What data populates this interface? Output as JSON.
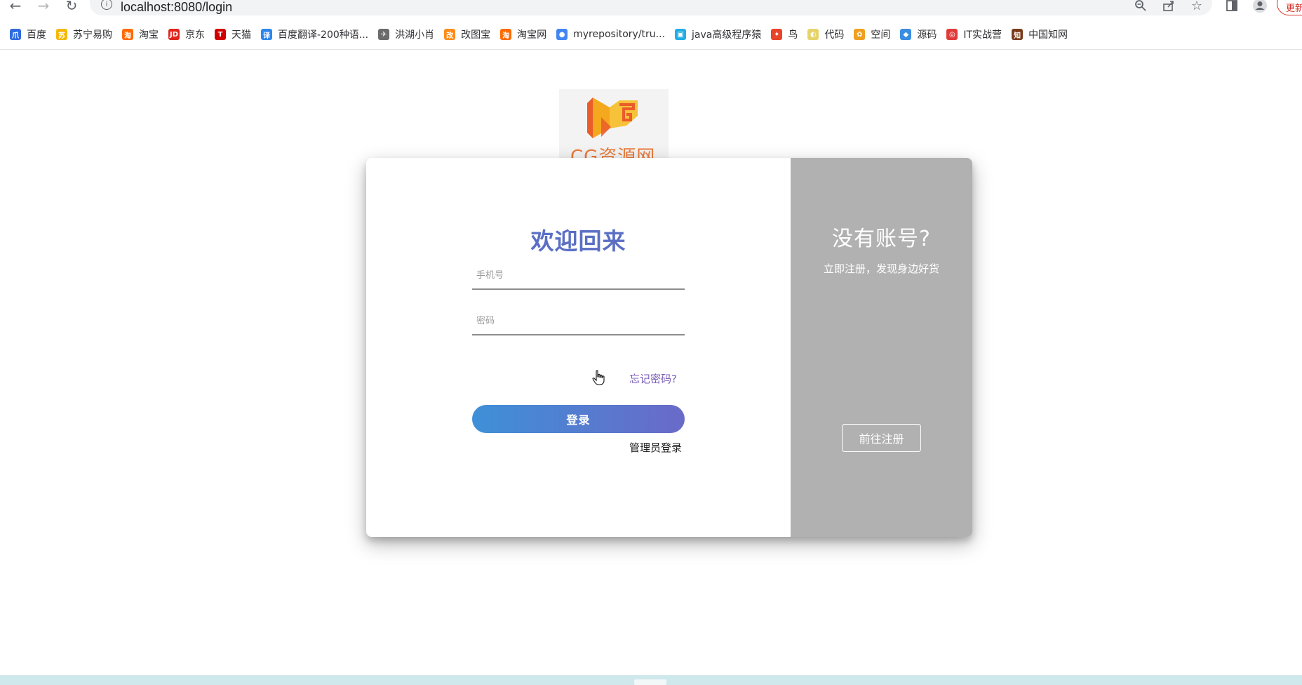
{
  "browser": {
    "url": "localhost:8080/login",
    "update_label": "更新",
    "bookmarks": [
      {
        "label": "百度",
        "icon": "baidu-paw-icon",
        "color": "#2f6be0"
      },
      {
        "label": "苏宁易购",
        "icon": "suning-icon",
        "color": "#f5b800"
      },
      {
        "label": "淘宝",
        "icon": "taobao-icon",
        "color": "#ff6a00"
      },
      {
        "label": "京东",
        "icon": "jd-icon",
        "color": "#e1251b"
      },
      {
        "label": "天猫",
        "icon": "tmall-icon",
        "color": "#d10000"
      },
      {
        "label": "百度翻译-200种语...",
        "icon": "translate-icon",
        "color": "#2e86ee"
      },
      {
        "label": "洪湖小肖",
        "icon": "bird-icon",
        "color": "#6b6b6b"
      },
      {
        "label": "改图宝",
        "icon": "gaitubao-icon",
        "color": "#ff8c1a"
      },
      {
        "label": "淘宝网",
        "icon": "taobao-icon",
        "color": "#ff6a00"
      },
      {
        "label": "myrepository/tru...",
        "icon": "chrome-icon",
        "color": "#4285f4"
      },
      {
        "label": "java高级程序猿",
        "icon": "bilibili-icon",
        "color": "#23ade5"
      },
      {
        "label": "鸟",
        "icon": "bird-icon",
        "color": "#e8442a"
      },
      {
        "label": "代码",
        "icon": "moon-icon",
        "color": "#e6d36a"
      },
      {
        "label": "空间",
        "icon": "qzone-icon",
        "color": "#f0a020"
      },
      {
        "label": "源码",
        "icon": "fish-icon",
        "color": "#3a8de0"
      },
      {
        "label": "IT实战营",
        "icon": "it-icon",
        "color": "#e03a3a"
      },
      {
        "label": "中国知网",
        "icon": "cnki-icon",
        "color": "#7a3b1a"
      }
    ],
    "bookmark_glyphs": [
      "爪",
      "苏",
      "淘",
      "JD",
      "T",
      "译",
      "✈",
      "改",
      "淘",
      "●",
      "▣",
      "✦",
      "◐",
      "✿",
      "◆",
      "◎",
      "知"
    ]
  },
  "logo": {
    "text": "CG资源网",
    "colors": {
      "orange": "#f4a81d",
      "red": "#ea5c2a"
    }
  },
  "login_form": {
    "title": "欢迎回来",
    "phone_placeholder": "手机号",
    "password_placeholder": "密码",
    "forgot_password": "忘记密码?",
    "login_button": "登录",
    "admin_login": "管理员登录"
  },
  "register_panel": {
    "title": "没有账号?",
    "subtitle": "立即注册，发现身边好货",
    "register_button": "前往注册"
  },
  "colors": {
    "title": "#5a6fc4",
    "button_gradient_start": "#3e90d8",
    "button_gradient_end": "#6a6ac8",
    "panel_bg": "#b1b1b1"
  }
}
